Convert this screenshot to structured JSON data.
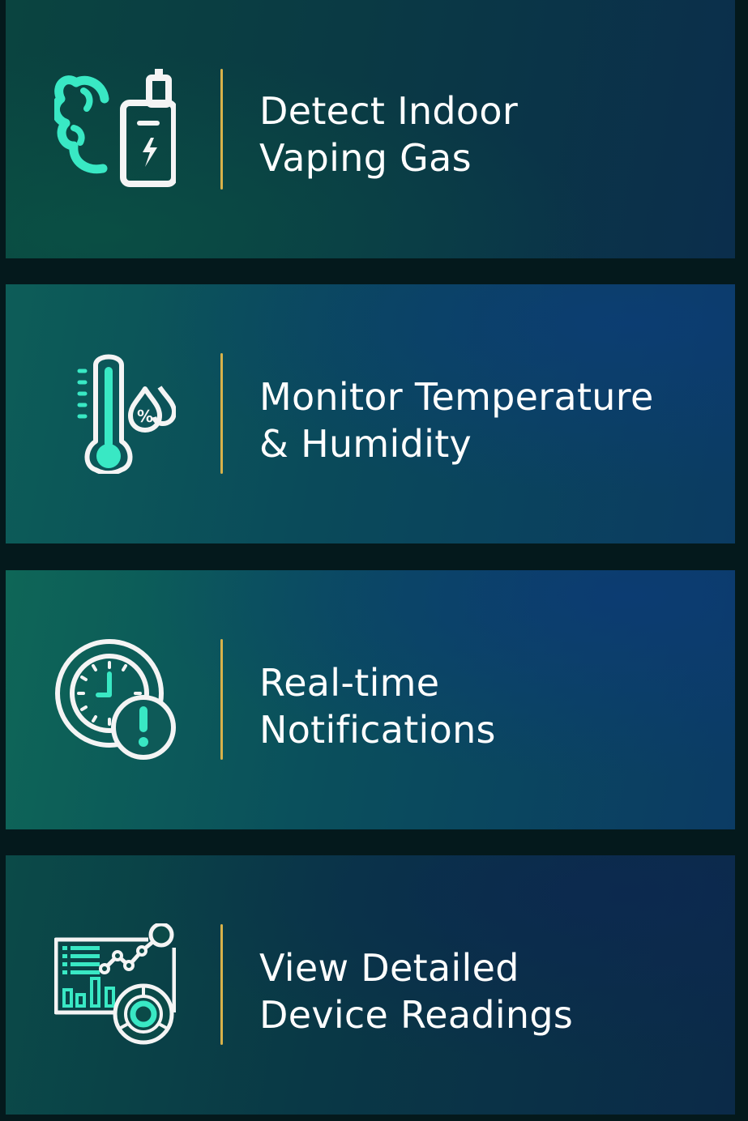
{
  "features": [
    {
      "title_line1": "Detect Indoor",
      "title_line2": "Vaping Gas",
      "icon": "vape-smoke-icon"
    },
    {
      "title_line1": "Monitor Temperature",
      "title_line2": "& Humidity",
      "icon": "thermometer-humidity-icon"
    },
    {
      "title_line1": "Real-time",
      "title_line2": "Notifications",
      "icon": "clock-alert-icon"
    },
    {
      "title_line1": "View Detailed",
      "title_line2": "Device Readings",
      "icon": "dashboard-readings-icon"
    }
  ],
  "colors": {
    "accent": "#39e8c4",
    "divider": "#d8b24a",
    "text": "#ffffff",
    "background": "#04191c"
  }
}
